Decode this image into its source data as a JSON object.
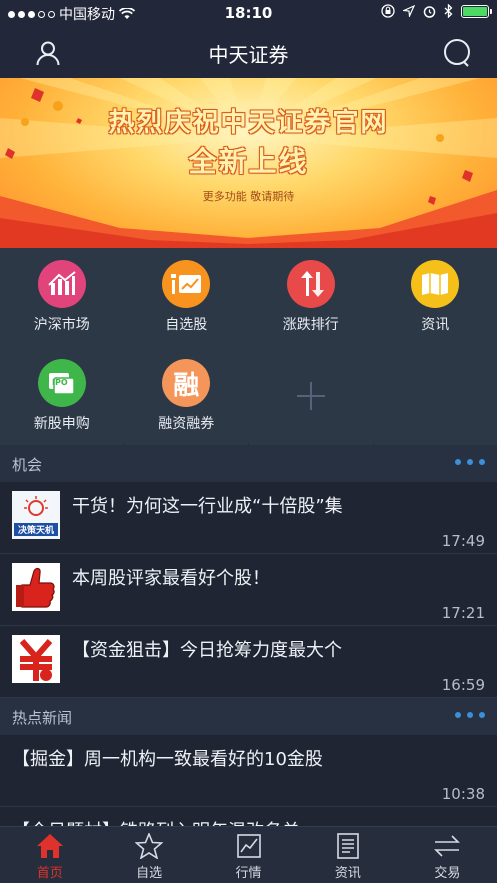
{
  "status_bar": {
    "carrier": "中国移动",
    "time": "18:10",
    "battery_level": 1.0,
    "signal_bars_filled": 3,
    "signal_bars_total": 5
  },
  "nav": {
    "title": "中天证券",
    "profile_icon": "user-icon",
    "search_icon": "search-icon"
  },
  "banner": {
    "title_line1": "热烈庆祝中天证券官网",
    "title_line2": "全新上线",
    "subtitle": "更多功能 敬请期待"
  },
  "grid": {
    "items": [
      {
        "label": "沪深市场",
        "icon": "chart-bars-icon",
        "color": "#e0447a"
      },
      {
        "label": "自选股",
        "icon": "watchlist-icon",
        "color": "#f7931e"
      },
      {
        "label": "涨跌排行",
        "icon": "up-down-arrows-icon",
        "color": "#e84a4a"
      },
      {
        "label": "资讯",
        "icon": "map-book-icon",
        "color": "#f6c01a"
      },
      {
        "label": "新股申购",
        "icon": "ipo-icon",
        "color": "#3fb64a"
      },
      {
        "label": "融资融券",
        "icon": "rong-icon",
        "color": "#f4955a",
        "glyph": "融"
      },
      {
        "label": "",
        "icon": "add-icon"
      }
    ],
    "ipo_text": "IPO"
  },
  "section1": {
    "title": "机会"
  },
  "news1": [
    {
      "title": "干货！为何这一行业成“十倍股”集",
      "time": "17:49",
      "thumb_text": "决策天机"
    },
    {
      "title": "本周股评家最看好个股！",
      "time": "17:21"
    },
    {
      "title": "【资金狙击】今日抢筹力度最大个",
      "time": "16:59"
    }
  ],
  "section2": {
    "title": "热点新闻"
  },
  "news2": [
    {
      "title": "【掘金】周一机构一致最看好的10金股",
      "time": "10:38"
    },
    {
      "title": "【今日题材】铁路列入明年混改名单"
    }
  ],
  "tabbar": {
    "tabs": [
      {
        "label": "首页",
        "icon": "home-icon",
        "active": true
      },
      {
        "label": "自选",
        "icon": "star-icon"
      },
      {
        "label": "行情",
        "icon": "market-chart-icon"
      },
      {
        "label": "资讯",
        "icon": "news-doc-icon"
      },
      {
        "label": "交易",
        "icon": "trade-arrows-icon"
      }
    ],
    "active_color": "#e0322c"
  }
}
